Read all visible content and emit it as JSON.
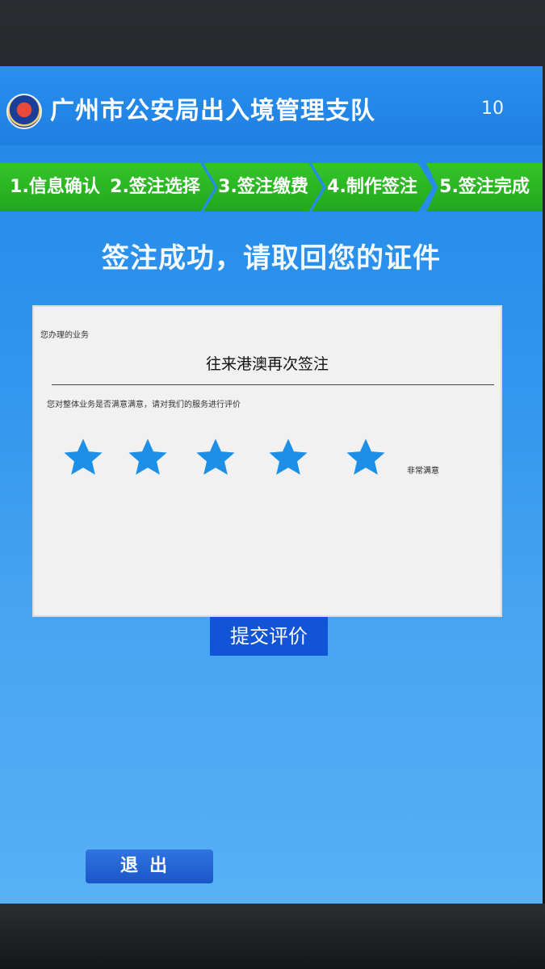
{
  "header": {
    "title": "广州市公安局出入境管理支队",
    "countdown": "10",
    "emblem_icon": "police-emblem-icon"
  },
  "steps": [
    {
      "label": "1.信息确认"
    },
    {
      "label": "2.签注选择"
    },
    {
      "label": "3.签注缴费"
    },
    {
      "label": "4.制作签注"
    },
    {
      "label": "5.签注完成"
    }
  ],
  "message": "签注成功，请取回您的证件",
  "card": {
    "service_label": "您办理的业务",
    "service_name": "往来港澳再次签注",
    "rating_question": "您对整体业务是否满意满意，请对我们的服务进行评价",
    "rating_value": 5,
    "rating_max": 5,
    "rating_text": "非常满意"
  },
  "buttons": {
    "submit": "提交评价",
    "exit": "退出"
  },
  "colors": {
    "screen_blue": "#2f95ee",
    "step_green": "#2bb524",
    "star_blue": "#1e8fe6",
    "submit_blue": "#1254d6"
  }
}
